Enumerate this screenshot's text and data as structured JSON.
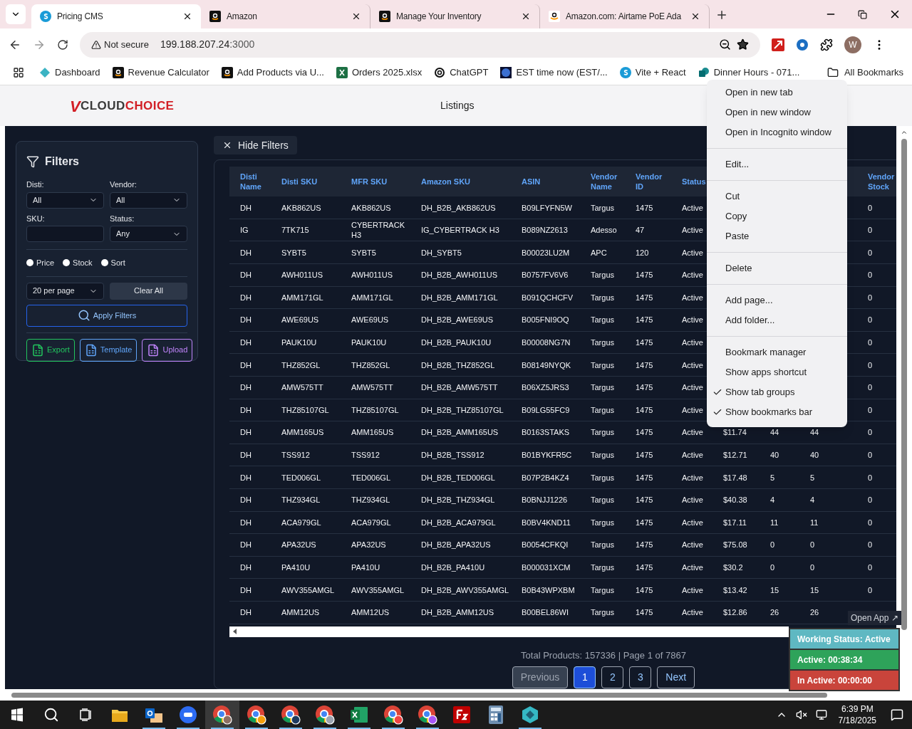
{
  "browser": {
    "tabs": [
      {
        "title": "Pricing CMS",
        "selected": true
      },
      {
        "title": "Amazon",
        "selected": false
      },
      {
        "title": "Manage Your Inventory",
        "selected": false
      },
      {
        "title": "Amazon.com: Airtame PoE Ada",
        "selected": false
      }
    ],
    "security": "Not secure",
    "url_host": "199.188.207.24",
    "url_port": ":3000",
    "profile_initial": "W",
    "bookmarks": [
      "Dashboard",
      "Revenue Calculator",
      "Add Products via U...",
      "Orders 2025.xlsx",
      "ChatGPT",
      "EST time now (EST/...",
      "Vite + React",
      "Dinner Hours - 071..."
    ],
    "all_bookmarks": "All Bookmarks"
  },
  "header": {
    "logo": [
      "V",
      "CLOUD",
      "CHOICE"
    ],
    "title": "Listings"
  },
  "filters": {
    "title": "Filters",
    "disti": {
      "label": "Disti:",
      "value": "All"
    },
    "vendor": {
      "label": "Vendor:",
      "value": "All"
    },
    "sku": {
      "label": "SKU:"
    },
    "status": {
      "label": "Status:",
      "value": "Any"
    },
    "radios": [
      {
        "label": "Price",
        "selected": false
      },
      {
        "label": "Stock",
        "selected": false
      },
      {
        "label": "Sort",
        "selected": false
      }
    ],
    "per_page": "20 per page",
    "clear": "Clear All",
    "apply": "Apply Filters",
    "actions": [
      {
        "label": "Export",
        "color": "#22c55e"
      },
      {
        "label": "Template",
        "color": "#60a5fa"
      },
      {
        "label": "Upload",
        "color": "#c084fc"
      }
    ]
  },
  "hide_filters": "Hide Filters",
  "table": {
    "columns": [
      "Disti Name",
      "Disti SKU",
      "MFR SKU",
      "Amazon SKU",
      "ASIN",
      "Vendor Name",
      "Vendor ID",
      "Status",
      null,
      null,
      null,
      "Vendor Stock"
    ],
    "rows": [
      [
        "DH",
        "AKB862US",
        "AKB862US",
        "DH_B2B_AKB862US",
        "B09LFYFN5W",
        "Targus",
        "1475",
        "Active",
        null,
        null,
        null,
        "0"
      ],
      [
        "IG",
        "7TK715",
        "CYBERTRACK H3",
        "IG_CYBERTRACK H3",
        "B089NZ2613",
        "Adesso",
        "47",
        "Active",
        null,
        null,
        null,
        "0"
      ],
      [
        "DH",
        "SYBT5",
        "SYBT5",
        "DH_SYBT5",
        "B00023LU2M",
        "APC",
        "120",
        "Active",
        null,
        null,
        null,
        "0"
      ],
      [
        "DH",
        "AWH011US",
        "AWH011US",
        "DH_B2B_AWH011US",
        "B0757FV6V6",
        "Targus",
        "1475",
        "Active",
        null,
        null,
        null,
        "0"
      ],
      [
        "DH",
        "AMM171GL",
        "AMM171GL",
        "DH_B2B_AMM171GL",
        "B091QCHCFV",
        "Targus",
        "1475",
        "Active",
        null,
        null,
        null,
        "0"
      ],
      [
        "DH",
        "AWE69US",
        "AWE69US",
        "DH_B2B_AWE69US",
        "B005FNI9OQ",
        "Targus",
        "1475",
        "Active",
        null,
        null,
        null,
        "0"
      ],
      [
        "DH",
        "PAUK10U",
        "PAUK10U",
        "DH_B2B_PAUK10U",
        "B00008NG7N",
        "Targus",
        "1475",
        "Active",
        null,
        null,
        null,
        "0"
      ],
      [
        "DH",
        "THZ852GL",
        "THZ852GL",
        "DH_B2B_THZ852GL",
        "B08149NYQK",
        "Targus",
        "1475",
        "Active",
        null,
        null,
        null,
        "0"
      ],
      [
        "DH",
        "AMW575TT",
        "AMW575TT",
        "DH_B2B_AMW575TT",
        "B06XZ5JRS3",
        "Targus",
        "1475",
        "Active",
        null,
        null,
        null,
        "0"
      ],
      [
        "DH",
        "THZ85107GL",
        "THZ85107GL",
        "DH_B2B_THZ85107GL",
        "B09LG55FC9",
        "Targus",
        "1475",
        "Active",
        null,
        null,
        null,
        "0"
      ],
      [
        "DH",
        "AMM165US",
        "AMM165US",
        "DH_B2B_AMM165US",
        "B0163STAKS",
        "Targus",
        "1475",
        "Active",
        "$11.74",
        "44",
        "44",
        "0"
      ],
      [
        "DH",
        "TSS912",
        "TSS912",
        "DH_B2B_TSS912",
        "B01BYKFR5C",
        "Targus",
        "1475",
        "Active",
        "$12.71",
        "40",
        "40",
        "0"
      ],
      [
        "DH",
        "TED006GL",
        "TED006GL",
        "DH_B2B_TED006GL",
        "B07P2B4KZ4",
        "Targus",
        "1475",
        "Active",
        "$17.48",
        "5",
        "5",
        "0"
      ],
      [
        "DH",
        "THZ934GL",
        "THZ934GL",
        "DH_B2B_THZ934GL",
        "B0BNJJ1226",
        "Targus",
        "1475",
        "Active",
        "$40.38",
        "4",
        "4",
        "0"
      ],
      [
        "DH",
        "ACA979GL",
        "ACA979GL",
        "DH_B2B_ACA979GL",
        "B0BV4KND11",
        "Targus",
        "1475",
        "Active",
        "$17.11",
        "11",
        "11",
        "0"
      ],
      [
        "DH",
        "APA32US",
        "APA32US",
        "DH_B2B_APA32US",
        "B0054CFKQI",
        "Targus",
        "1475",
        "Active",
        "$75.08",
        "0",
        "0",
        "0"
      ],
      [
        "DH",
        "PA410U",
        "PA410U",
        "DH_B2B_PA410U",
        "B000031XCM",
        "Targus",
        "1475",
        "Active",
        "$30.2",
        "0",
        "0",
        "0"
      ],
      [
        "DH",
        "AWV355AMGL",
        "AWV355AMGL",
        "DH_B2B_AWV355AMGL",
        "B0B43WPXBM",
        "Targus",
        "1475",
        "Active",
        "$13.42",
        "15",
        "15",
        "0"
      ],
      [
        "DH",
        "AMM12US",
        "AMM12US",
        "DH_B2B_AMM12US",
        "B00BEL86WI",
        "Targus",
        "1475",
        "Active",
        "$12.86",
        "26",
        "26",
        null
      ]
    ]
  },
  "summary": "Total Products: 157336 | Page 1 of 7867",
  "pagination": {
    "previous": {
      "label": "Previous",
      "disabled": true
    },
    "pages": [
      {
        "label": "1",
        "selected": true
      },
      {
        "label": "2",
        "selected": false
      },
      {
        "label": "3",
        "selected": false
      }
    ],
    "next": {
      "label": "Next",
      "disabled": false
    }
  },
  "context_menu": [
    {
      "kind": "item",
      "label": "Open in new tab",
      "checked": false
    },
    {
      "kind": "item",
      "label": "Open in new window",
      "checked": false
    },
    {
      "kind": "item",
      "label": "Open in Incognito window",
      "checked": false
    },
    {
      "kind": "separator"
    },
    {
      "kind": "item",
      "label": "Edit...",
      "checked": false
    },
    {
      "kind": "separator"
    },
    {
      "kind": "item",
      "label": "Cut",
      "checked": false
    },
    {
      "kind": "item",
      "label": "Copy",
      "checked": false
    },
    {
      "kind": "item",
      "label": "Paste",
      "checked": false
    },
    {
      "kind": "separator"
    },
    {
      "kind": "item",
      "label": "Delete",
      "checked": false
    },
    {
      "kind": "separator"
    },
    {
      "kind": "item",
      "label": "Add page...",
      "checked": false
    },
    {
      "kind": "item",
      "label": "Add folder...",
      "checked": false
    },
    {
      "kind": "separator"
    },
    {
      "kind": "item",
      "label": "Bookmark manager",
      "checked": false
    },
    {
      "kind": "item",
      "label": "Show apps shortcut",
      "checked": false
    },
    {
      "kind": "item",
      "label": "Show tab groups",
      "checked": true
    },
    {
      "kind": "item",
      "label": "Show bookmarks bar",
      "checked": true
    }
  ],
  "tracker": {
    "open_app": "Open App ↗",
    "status": "Working Status: Active",
    "active": "Active: 00:38:34",
    "inactive": "In Active: 00:00:00"
  },
  "taskbar": {
    "apps": [
      {
        "kind": "explorer",
        "running": false,
        "selected": false
      },
      {
        "kind": "outlook",
        "running": true,
        "selected": false
      },
      {
        "kind": "zoom",
        "running": true,
        "selected": false
      },
      {
        "kind": "chrome",
        "running": true,
        "selected": true
      },
      {
        "kind": "chrome",
        "running": true,
        "selected": false
      },
      {
        "kind": "chrome",
        "running": true,
        "selected": false
      },
      {
        "kind": "chrome",
        "running": true,
        "selected": false
      },
      {
        "kind": "excel",
        "running": true,
        "selected": false
      },
      {
        "kind": "chrome",
        "running": true,
        "selected": false
      },
      {
        "kind": "chrome",
        "running": true,
        "selected": false
      },
      {
        "kind": "filezilla",
        "running": false,
        "selected": false
      },
      {
        "kind": "calculator",
        "running": false,
        "selected": false
      },
      {
        "kind": "teal",
        "running": true,
        "selected": false
      }
    ],
    "time": "6:39 PM",
    "date": "7/18/2025"
  }
}
